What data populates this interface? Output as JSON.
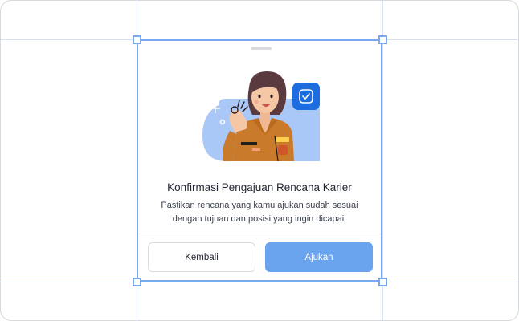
{
  "dialog": {
    "title": "Konfirmasi Pengajuan Rencana Karier",
    "description": "Pastikan rencana yang kamu ajukan sudah sesuai dengan tujuan dan posisi yang ingin dicapai.",
    "back_label": "Kembali",
    "submit_label": "Ajukan"
  },
  "colors": {
    "accent": "#6aa3ee",
    "selection_border": "#7aa8ee",
    "guide_lines": "#d5e0f7",
    "badge": "#1c6de0",
    "illustration_bg": "#a9c8f7",
    "uniform": "#c97a2a"
  },
  "icons": {
    "badge": "check-badge-icon",
    "sparkle": "sparkle-icon"
  }
}
